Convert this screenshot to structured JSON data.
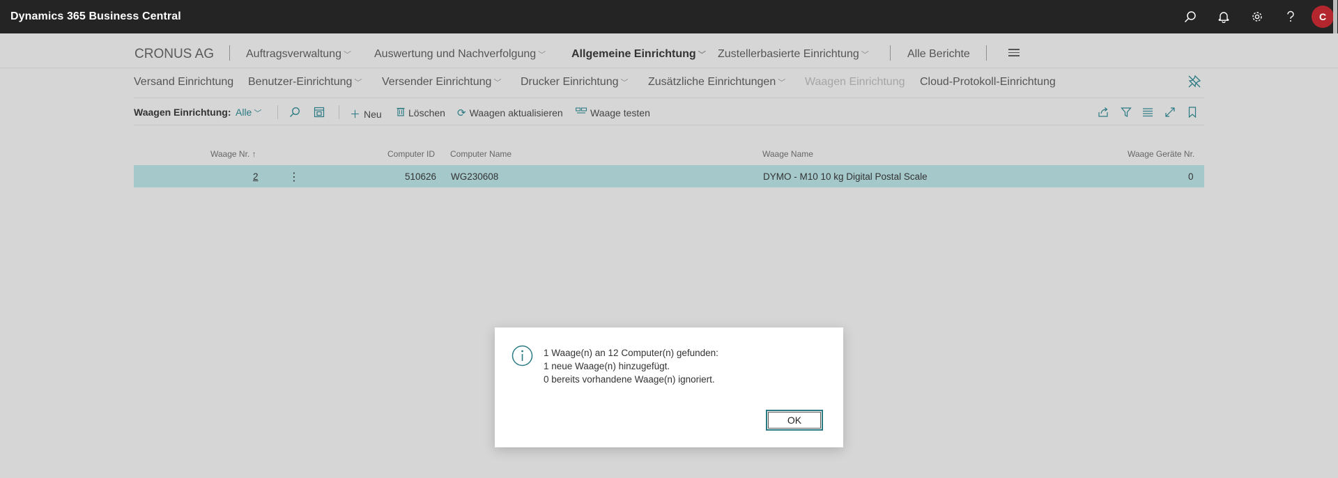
{
  "app": {
    "title": "Dynamics 365 Business Central",
    "user_initial": "C"
  },
  "rolenav": {
    "company": "CRONUS AG",
    "items": [
      "Auftragsverwaltung",
      "Auswertung und Nachverfolgung",
      "Allgemeine Einrichtung",
      "Zustellerbasierte Einrichtung",
      "Alle Berichte"
    ]
  },
  "subnav": {
    "items": [
      "Versand Einrichtung",
      "Benutzer-Einrichtung",
      "Versender Einrichtung",
      "Drucker Einrichtung",
      "Zusätzliche Einrichtungen",
      "Waagen Einrichtung",
      "Cloud-Protokoll-Einrichtung"
    ]
  },
  "actionbar": {
    "page_label": "Waagen Einrichtung:",
    "filter": "Alle",
    "new": "Neu",
    "delete": "Löschen",
    "refresh": "Waagen aktualisieren",
    "test": "Waage testen"
  },
  "table": {
    "columns": [
      "Waage Nr.",
      "Computer ID",
      "Computer Name",
      "Waage Name",
      "Waage Geräte Nr."
    ],
    "sort_indicator": "↑",
    "rows": [
      {
        "no": "2",
        "computer_id": "510626",
        "computer_name": "WG230608",
        "scale_name": "DYMO - M10 10 kg Digital Postal Scale",
        "device_no": "0"
      }
    ]
  },
  "dialog": {
    "lines": [
      "1 Waage(n) an 12 Computer(n) gefunden:",
      "1 neue Waage(n) hinzugefügt.",
      "0 bereits vorhandene Waage(n) ignoriert."
    ],
    "ok": "OK"
  },
  "colors": {
    "accent": "#2b7a83",
    "selected_row": "#a5c8cb",
    "appbar": "#242424",
    "avatar": "#b3262d"
  }
}
